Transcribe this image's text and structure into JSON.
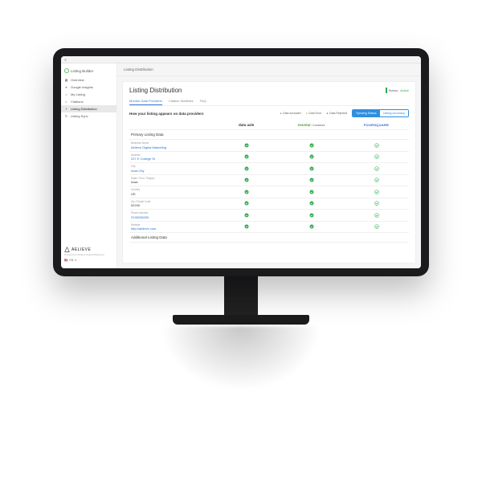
{
  "brand": "Listing Builder",
  "breadcrumb": "Listing Distribution",
  "sidebar": {
    "items": [
      {
        "label": "Overview"
      },
      {
        "label": "Google Insights"
      },
      {
        "label": "My Listing"
      },
      {
        "label": "Citations"
      },
      {
        "label": "Listing Distribution"
      },
      {
        "label": "Listing Sync"
      }
    ],
    "logo": "AELIEVE",
    "powered": "Powered by Aelieve Digital Marketing",
    "lang": "EN"
  },
  "panel": {
    "title": "Listing Distribution",
    "status_label": "Status:",
    "status_value": "Active",
    "tabs": [
      "Monitor Data Providers",
      "Citation Statistics",
      "FAQ"
    ],
    "subtitle": "How your listing appears on data providers",
    "legend": {
      "ok": "Data accepted",
      "warn": "Data Error",
      "err": "Data Rejected"
    },
    "toggle": {
      "on": "Syncing Status",
      "off": "Listing Accuracy"
    },
    "providers": {
      "da": "data axle",
      "ns": "neustar",
      "ns2": "/ Localeze",
      "fs": "FOURSQUARE"
    },
    "section1": "Primary Listing Data",
    "section2": "Additional Listing Data",
    "rows": [
      {
        "label": "Business Name",
        "value": "Aelieve Digital Marketing"
      },
      {
        "label": "Address",
        "value": "227 E College St"
      },
      {
        "label": "City",
        "value": "Iowa City"
      },
      {
        "label": "State / Prov / Region",
        "value": "Iowa"
      },
      {
        "label": "Country",
        "value": "US"
      },
      {
        "label": "Zip / Postal Code",
        "value": "52240"
      },
      {
        "label": "Phone Number",
        "value": "3195298200"
      },
      {
        "label": "Website",
        "value": "http://aelieve.com"
      }
    ]
  }
}
